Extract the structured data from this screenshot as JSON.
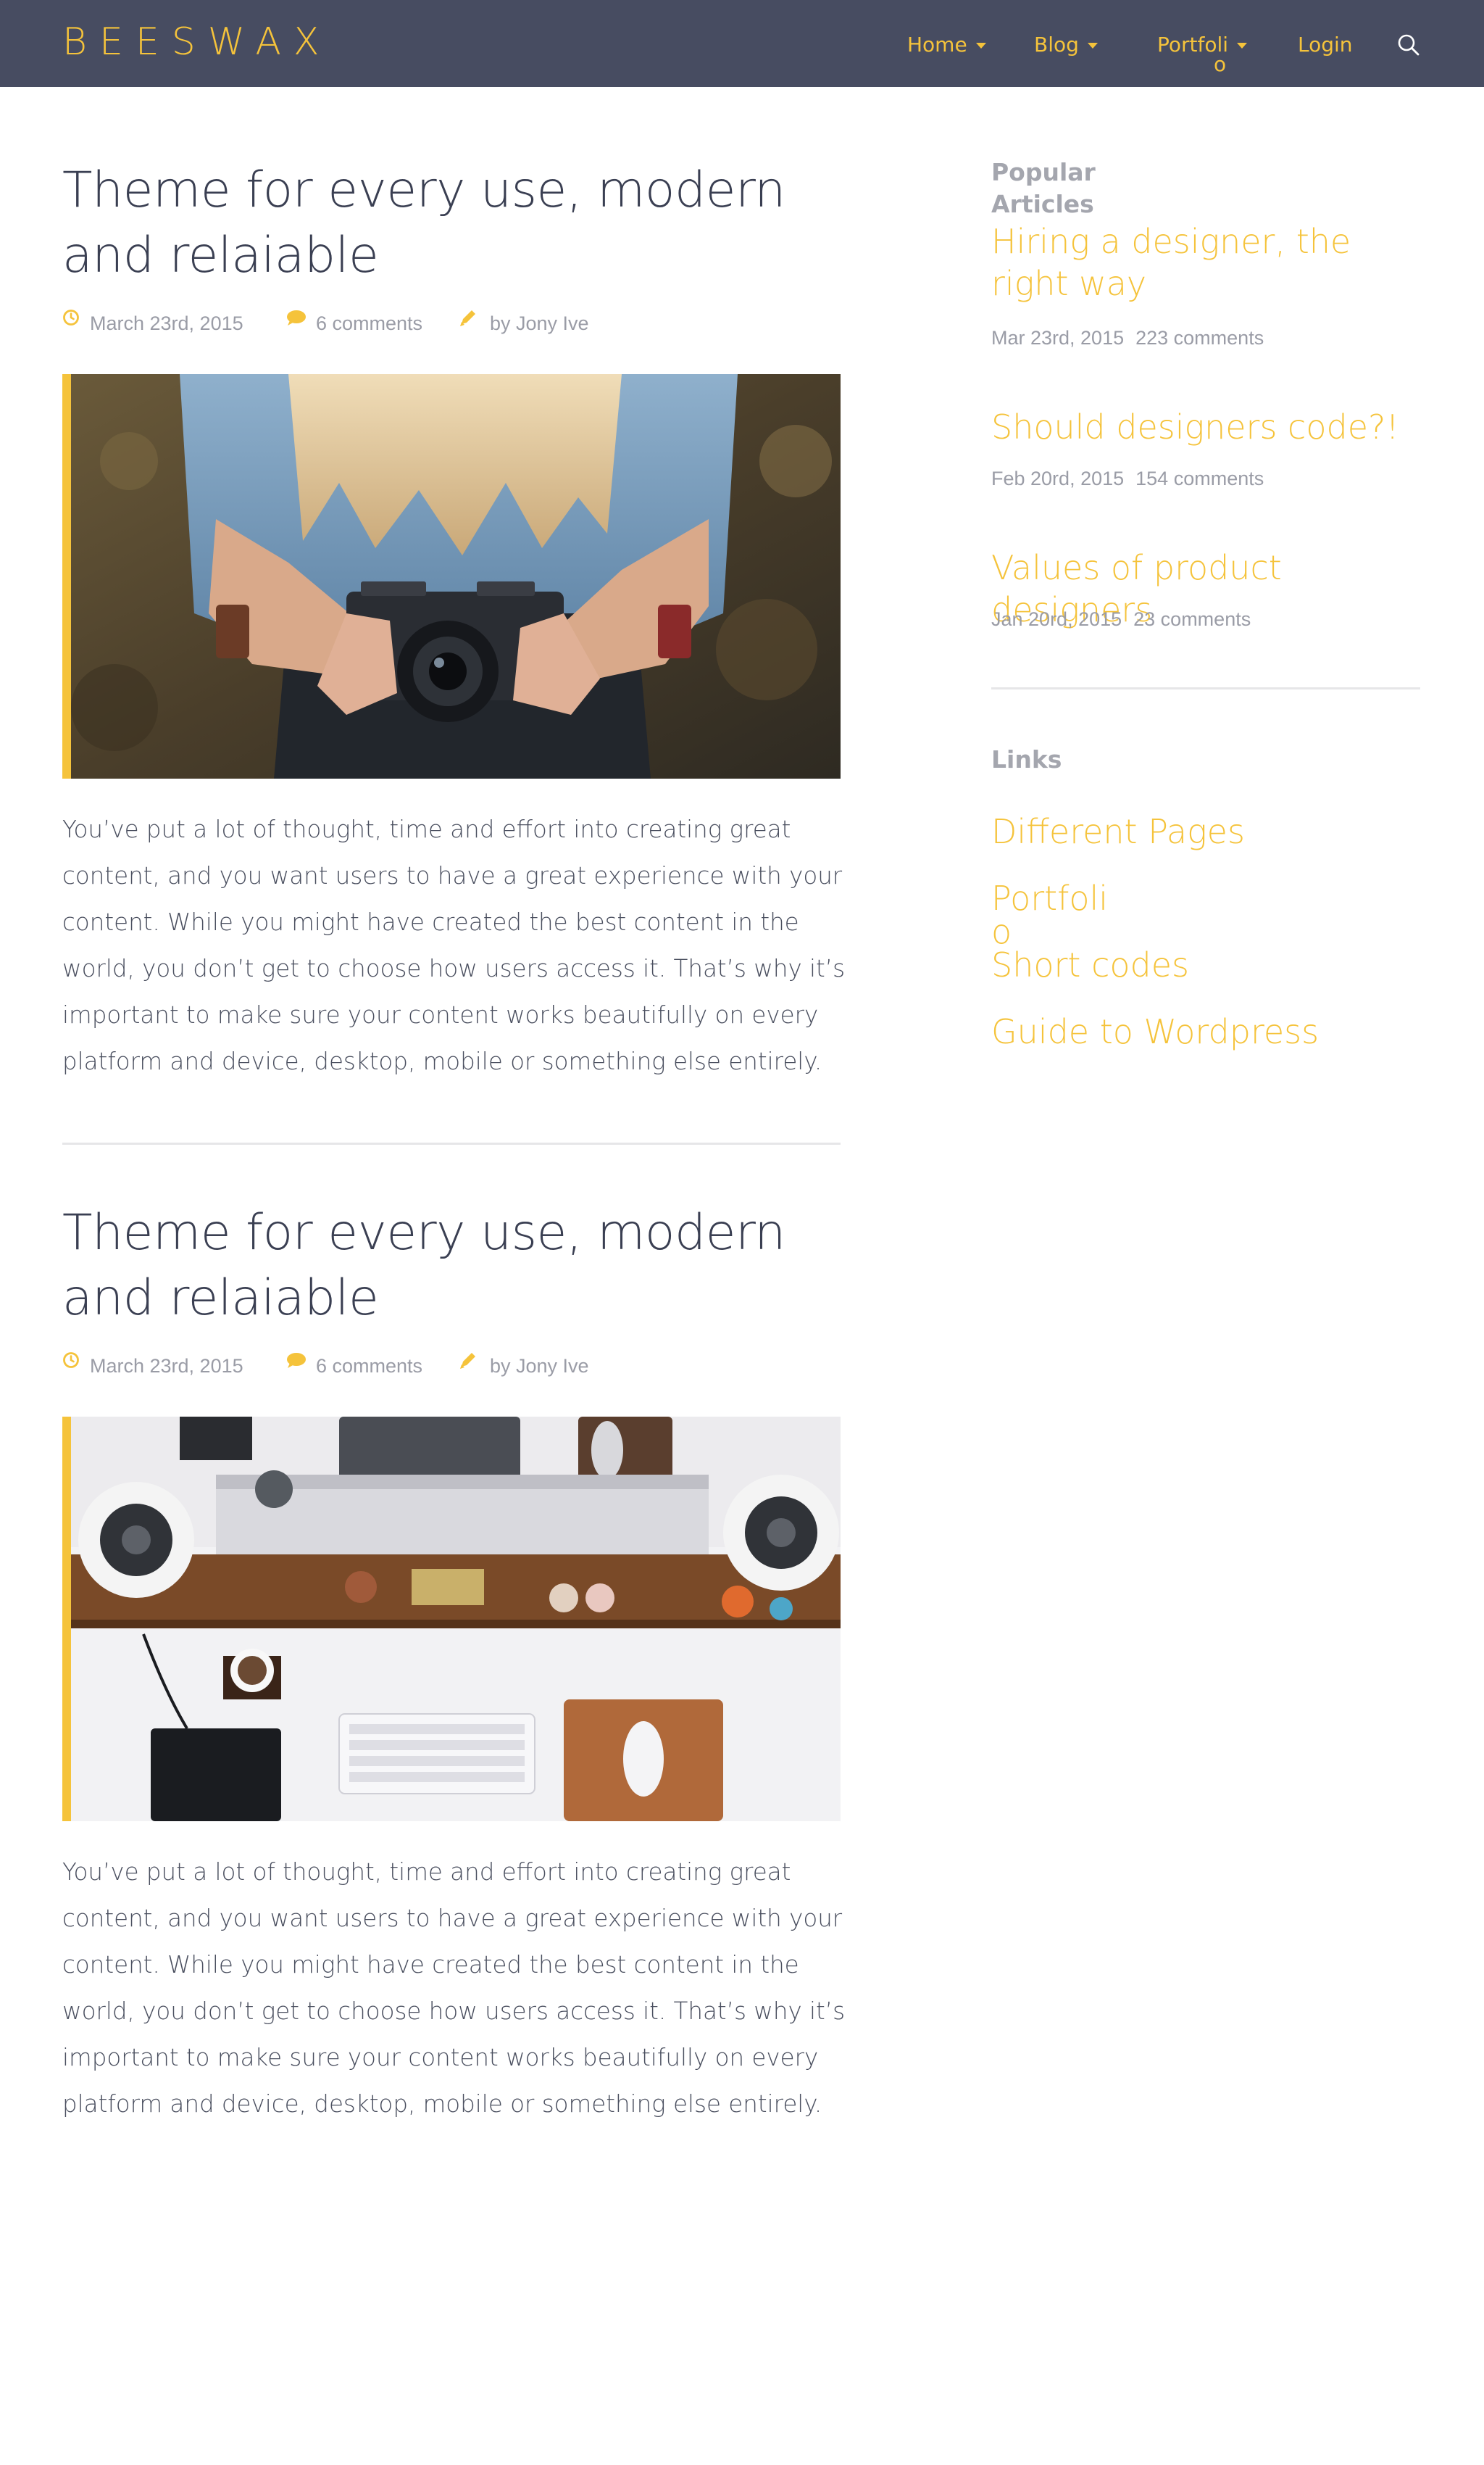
{
  "header": {
    "logo": "BEESWAX",
    "nav": {
      "home": "Home",
      "blog": "Blog",
      "portfolio_a": "Portfoli",
      "portfolio_b": "o",
      "login": "Login"
    }
  },
  "posts": [
    {
      "title": "Theme for every use, modern and relaiable",
      "date": "March 23rd, 2015",
      "comments": "6 comments",
      "author": "by Jony Ive",
      "body": "You’ve put a lot of thought, time and effort into creating great content, and you want users to have a great experience with your content. While you might have created the best content in the world, you don’t get to choose how users access it. That’s why it’s important to make sure your content works beautifully on every platform and device, desktop, mobile or something else entirely."
    },
    {
      "title": "Theme for every use, modern and relaiable",
      "date": "March 23rd, 2015",
      "comments": "6 comments",
      "author": "by Jony Ive",
      "body": "You’ve put a lot of thought, time and effort into creating great content, and you want users to have a great experience with your content. While you might have created the best content in the world, you don’t get to choose how users access it. That’s why it’s important to make sure your content works beautifully on every platform and device, desktop, mobile or something else entirely."
    }
  ],
  "sidebar": {
    "popular_heading": "Popular Articles",
    "articles": [
      {
        "title": "Hiring a designer, the right way",
        "date": "Mar 23rd, 2015",
        "comments": "223 comments"
      },
      {
        "title": "Should designers code?!",
        "date": "Feb 20rd, 2015",
        "comments": "154 comments"
      },
      {
        "title": "Values of product designers",
        "date": "Jan 20rd, 2015",
        "comments": "23 comments"
      }
    ],
    "links_heading": "Links",
    "links": [
      "Different Pages",
      "Portfolio",
      "Short codes",
      "Guide to Wordpress"
    ]
  },
  "colors": {
    "header_bg": "#474c61",
    "accent": "#f5c33b",
    "text": "#3a3f52",
    "muted": "#9a9ca6"
  }
}
